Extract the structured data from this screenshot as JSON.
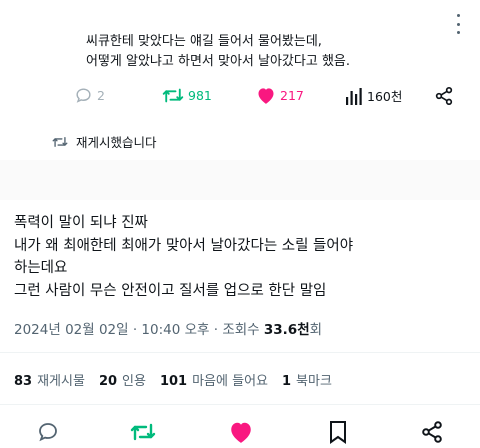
{
  "quoted": {
    "line1": "씨큐한테 맞았다는 얘길 들어서 물어봤는데,",
    "line2": "어떻게 알았냐고 하면서 맞아서 날아갔다고 했음."
  },
  "quoted_actions": {
    "reply_count": "2",
    "retweet_count": "981",
    "like_count": "217",
    "view_count": "160천"
  },
  "retweet_label": "재게시했습니다",
  "tweet": {
    "line1": "폭력이 말이 되냐 진짜",
    "line2": "내가 왜 최애한테 최애가 맞아서 날아갔다는 소릴 들어야",
    "line3": "하는데요",
    "line4": "그런 사람이 무슨 안전이고 질서를 업으로 한단 말임"
  },
  "meta": {
    "date": "2024년 02월 02일 · 10:40 오후 · 조회수 ",
    "views": "33.6천",
    "views_suffix": "회"
  },
  "stats": {
    "reposts_num": "83",
    "reposts_label": "재게시물",
    "quotes_num": "20",
    "quotes_label": "인용",
    "likes_num": "101",
    "likes_label": "마음에 들어요",
    "bookmarks_num": "1",
    "bookmarks_label": "북마크"
  },
  "colors": {
    "text": "#0f1419",
    "muted": "#536471",
    "retweet_green": "#00ba7c",
    "like_pink": "#f91880",
    "divider": "#eff3f4"
  }
}
